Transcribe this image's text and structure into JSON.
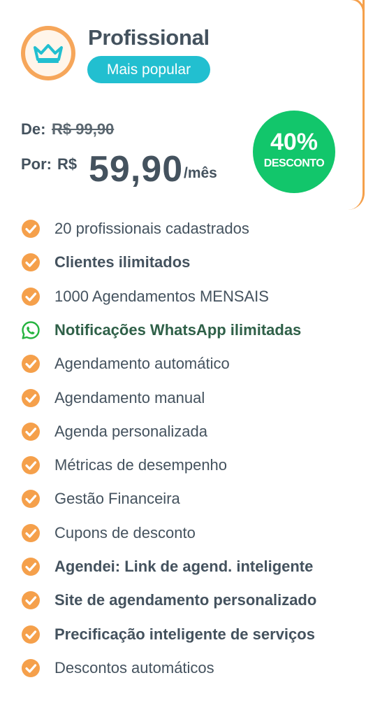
{
  "colors": {
    "accent_orange": "#f5a04b",
    "badge_cyan": "#22bfd0",
    "discount_green": "#12c66b",
    "text_dark": "#44525e",
    "whatsapp_green": "#25b33f"
  },
  "plan": {
    "logo_icon": "crown-icon",
    "name": "Profissional",
    "badge": "Mais popular"
  },
  "pricing": {
    "old_label": "De:",
    "old_price": "R$ 99,90",
    "now_label": "Por:",
    "currency": "R$",
    "price": "59,90",
    "period": "/mês"
  },
  "discount": {
    "percent": "40%",
    "label": "DESCONTO"
  },
  "features": [
    {
      "text": "20 profissionais cadastrados",
      "bold": false,
      "icon": "check-circle-icon"
    },
    {
      "text": "Clientes ilimitados",
      "bold": true,
      "icon": "check-circle-icon"
    },
    {
      "text": "1000 Agendamentos MENSAIS",
      "bold": false,
      "icon": "check-circle-icon"
    },
    {
      "text": "Notificações WhatsApp ilimitadas",
      "bold": true,
      "icon": "whatsapp-icon"
    },
    {
      "text": "Agendamento automático",
      "bold": false,
      "icon": "check-circle-icon"
    },
    {
      "text": "Agendamento manual",
      "bold": false,
      "icon": "check-circle-icon"
    },
    {
      "text": "Agenda personalizada",
      "bold": false,
      "icon": "check-circle-icon"
    },
    {
      "text": "Métricas de desempenho",
      "bold": false,
      "icon": "check-circle-icon"
    },
    {
      "text": "Gestão Financeira",
      "bold": false,
      "icon": "check-circle-icon"
    },
    {
      "text": "Cupons de desconto",
      "bold": false,
      "icon": "check-circle-icon"
    },
    {
      "text": "Agendei: Link de agend. inteligente",
      "bold": true,
      "icon": "check-circle-icon"
    },
    {
      "text": "Site de agendamento personalizado",
      "bold": true,
      "icon": "check-circle-icon"
    },
    {
      "text": "Precificação inteligente de serviços",
      "bold": true,
      "icon": "check-circle-icon"
    },
    {
      "text": "Descontos automáticos",
      "bold": false,
      "icon": "check-circle-icon"
    }
  ]
}
